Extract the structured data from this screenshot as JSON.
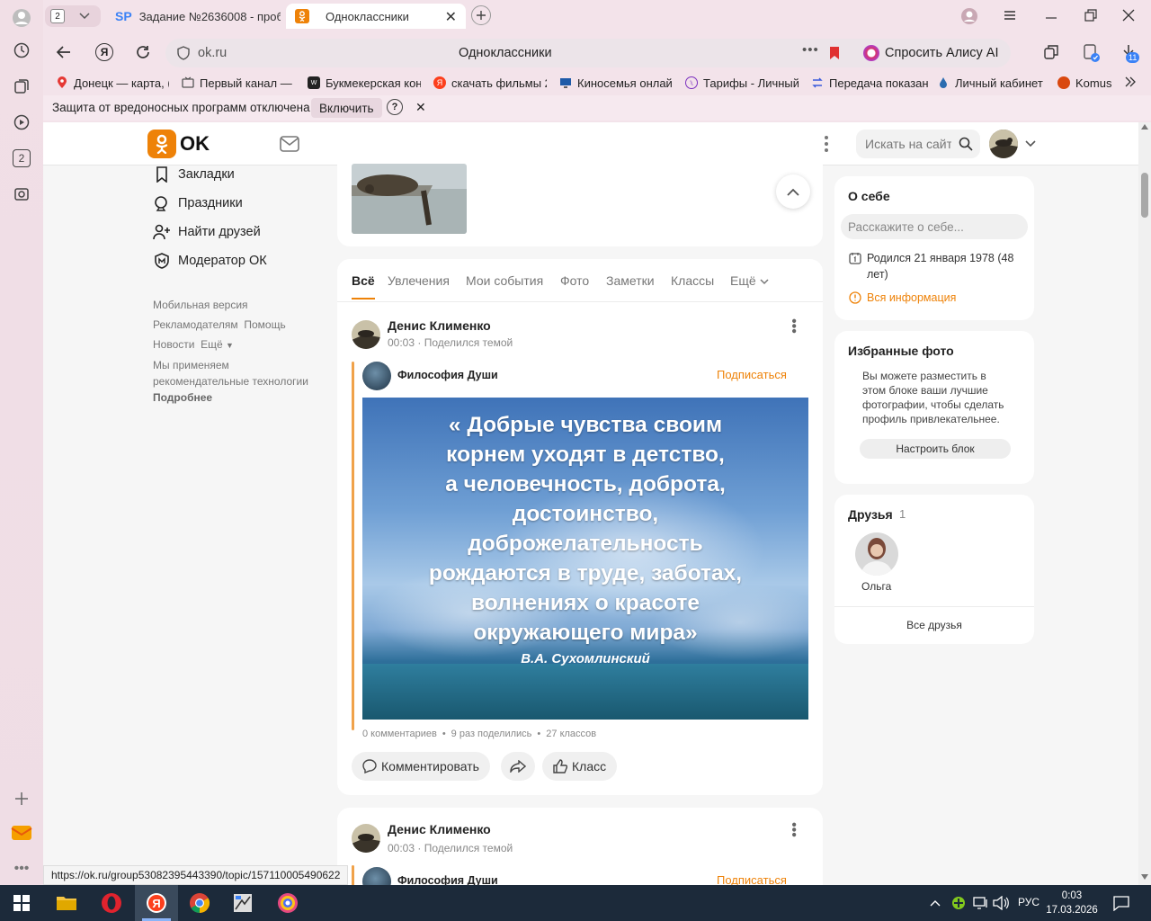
{
  "browser": {
    "tab_counter": "2",
    "tabs": [
      {
        "label": "Задание №2636008 - проб",
        "icon": "sp-icon"
      },
      {
        "label": "Одноклассники",
        "icon": "ok-icon"
      }
    ],
    "address": {
      "url": "ok.ru",
      "title": "Одноклассники"
    },
    "alice_button": "Спросить Алису AI",
    "downloads_badge": "11",
    "bookmarks": [
      {
        "label": "Донецк — карта, (",
        "icon": "map-pin-icon",
        "color": "#e53935"
      },
      {
        "label": "Первый канал — с",
        "icon": "tv-icon",
        "color": "#555"
      },
      {
        "label": "Букмекерская кон",
        "icon": "bet-icon",
        "color": "#333"
      },
      {
        "label": "скачать фильмы 2",
        "icon": "yandex-icon",
        "color": "#fc3f1d"
      },
      {
        "label": "Киносемья онлайн",
        "icon": "monitor-icon",
        "color": "#1e5aa8"
      },
      {
        "label": "Тарифы - Личный",
        "icon": "tariff-icon",
        "color": "#7b2fbe"
      },
      {
        "label": "Передача показан",
        "icon": "transfer-icon",
        "color": "#3b5bdb"
      },
      {
        "label": "Личный кабинет",
        "icon": "drop-icon",
        "color": "#2b6cb0"
      },
      {
        "label": "Komus",
        "icon": "komus-icon",
        "color": "#d9480f"
      }
    ],
    "infobar": {
      "text": "Защита от вредоносных программ отключена",
      "button": "Включить",
      "help": "?"
    },
    "status_link": "https://ok.ru/group53082395443390/topic/157110005490622"
  },
  "ok": {
    "logo_text": "OK",
    "search_placeholder": "Искать на сайте",
    "brand_color": "#ee8208",
    "left_nav": [
      {
        "label": "Закладки",
        "icon": "bookmark-icon"
      },
      {
        "label": "Праздники",
        "icon": "holiday-icon"
      },
      {
        "label": "Найти друзей",
        "icon": "add-friend-icon"
      },
      {
        "label": "Модератор ОК",
        "icon": "moderator-icon"
      }
    ],
    "footer_links": {
      "mobile": "Мобильная версия",
      "ads": "Рекламодателям",
      "help": "Помощь",
      "news": "Новости",
      "more": "Ещё",
      "tech_line1": "Мы применяем",
      "tech_line2": "рекомендательные технологии",
      "details": "Подробнее"
    },
    "feed_tabs": [
      "Всё",
      "Увлечения",
      "Мои события",
      "Фото",
      "Заметки",
      "Классы",
      "Ещё"
    ],
    "posts": [
      {
        "author": "Денис Клименко",
        "meta": "00:03 · Поделился темой",
        "group": "Философия Души",
        "subscribe": "Подписаться",
        "quote": [
          "« Добрые чувства своим",
          "корнем уходят в детство,",
          "а человечность, доброта,",
          "достоинство,",
          "доброжелательность",
          "рождаются в труде, заботах,",
          "волнениях о красоте",
          "окружающего мира»"
        ],
        "quote_author": "В.А. Сухомлинский",
        "stats": {
          "comments": "0 комментариев",
          "shares": "9 раз поделились",
          "likes": "27 классов"
        },
        "actions": {
          "comment": "Комментировать",
          "klass": "Класс"
        }
      },
      {
        "author": "Денис Клименко",
        "meta": "00:03 · Поделился темой",
        "group": "Философия Души",
        "subscribe": "Подписаться"
      }
    ],
    "about": {
      "title": "О себе",
      "placeholder": "Расскажите о себе...",
      "birth_line1": "Родился 21 января 1978 (48",
      "birth_line2": "лет)",
      "all_info": "Вся информация"
    },
    "fav_photos": {
      "title": "Избранные фото",
      "text": [
        "Вы можете разместить в",
        "этом блоке ваши лучшие",
        "фотографии, чтобы сделать",
        "профиль привлекательнее."
      ],
      "button": "Настроить блок"
    },
    "friends": {
      "title": "Друзья",
      "count": "1",
      "names": [
        "Ольга"
      ],
      "all": "Все друзья"
    }
  },
  "taskbar": {
    "lang": "РУС",
    "time": "0:03",
    "date": "17.03.2026"
  }
}
